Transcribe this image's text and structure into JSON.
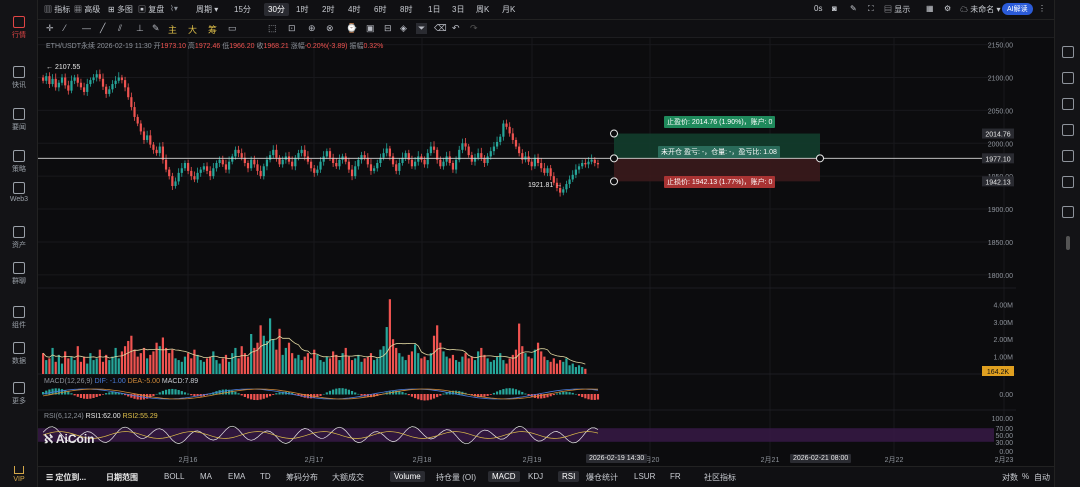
{
  "sidebar": {
    "items": [
      {
        "label": "行情",
        "icon": "bar-chart-icon",
        "active": true
      },
      {
        "label": "快讯",
        "icon": "flash-icon"
      },
      {
        "label": "要闻",
        "icon": "news-icon"
      },
      {
        "label": "策略",
        "icon": "strategy-icon"
      },
      {
        "label": "Web3",
        "icon": "web3-icon"
      },
      {
        "label": "资产",
        "icon": "wallet-icon"
      },
      {
        "label": "群聊",
        "icon": "chat-icon"
      },
      {
        "label": "组件",
        "icon": "widget-icon"
      },
      {
        "label": "数据",
        "icon": "data-icon"
      },
      {
        "label": "更多",
        "icon": "more-icon"
      }
    ],
    "vip": "VIP"
  },
  "toolbar": {
    "indicator": "指标",
    "advanced": "高级",
    "multi": "多图",
    "replay": "复盘",
    "period": "周期",
    "intervals": [
      "15分",
      "30分",
      "1时",
      "2时",
      "4时",
      "6时",
      "8时",
      "1日",
      "3日",
      "周K",
      "月K"
    ],
    "selected_interval": "30分",
    "countdown": "0s",
    "display": "显示",
    "unnamed": "未命名",
    "ai": "AI解读"
  },
  "tools": {
    "main": "主",
    "big": "大",
    "fib": "筹"
  },
  "header": {
    "symbol": "ETH/USDT永续",
    "datetime": "2026-02-19 11:30",
    "open_label": "开",
    "open": "1973.10",
    "high_label": "高",
    "high": "1972.46",
    "low_label": "低",
    "low": "1966.20",
    "close_label": "收",
    "close": "1968.21",
    "change_label": "涨幅",
    "change": "-0.20%(-3.89)",
    "amplitude_label": "振幅",
    "amplitude": "0.32%"
  },
  "price_axis": {
    "ticks": [
      "2150.00",
      "2100.00",
      "2050.00",
      "2000.00",
      "1950.00",
      "1900.00",
      "1850.00",
      "1800.00"
    ],
    "tp_tag": "2014.76",
    "current_tag": "1977.10",
    "sl_tag": "1942.13"
  },
  "annotations": {
    "high_mark": "← 2107.55",
    "low_mark": "1921.81 →",
    "tp": "止盈价: 2014.76 (1.90%)，账户: 0",
    "pos": "未开仓 盈亏: -，仓量: -，盈亏比: 1.08",
    "sl": "止损价: 1942.13 (1.77%)，账户: 0"
  },
  "volume_axis": {
    "ticks": [
      "4.00M",
      "3.00M",
      "2.00M",
      "1.00M"
    ],
    "current": "164.2K"
  },
  "macd": {
    "label": "MACD(12,26,9)",
    "dif": "DIF: -1.00",
    "dea": "DEA:-5.00",
    "macd": "MACD:7.89",
    "axis": "0.00"
  },
  "rsi": {
    "label": "RSI(6,12,24)",
    "rsi1": "RSI1:62.00",
    "rsi2": "RSI2:55.29",
    "axis": [
      "100.00",
      "70.00",
      "50.00",
      "30.00",
      "0.00"
    ]
  },
  "x_axis": {
    "ticks": [
      "2月16",
      "2月17",
      "2月18",
      "2月19",
      "2月20",
      "2月21",
      "2月22",
      "2月23"
    ],
    "cursor_start": "2026-02-19 14:30",
    "cursor_end": "2026-02-21 08:00"
  },
  "watermark": "AiCoin",
  "bottom": {
    "locate": "定位到...",
    "date_range": "日期范围",
    "tabs": [
      "BOLL",
      "MA",
      "EMA",
      "TD",
      "筹码分布",
      "大额成交",
      "Volume",
      "持仓量 (OI)",
      "MACD",
      "KDJ",
      "RSI",
      "爆仓统计",
      "LSUR",
      "FR",
      "社区指标"
    ],
    "selected_tabs": [
      "Volume",
      "MACD",
      "RSI"
    ],
    "log": "对数",
    "pct": "%",
    "auto": "自动"
  },
  "colors": {
    "up": "#26a69a",
    "down": "#ef5350",
    "accent": "#2b5bd8",
    "rsi_band": "#3a1a4a"
  },
  "chart_data": {
    "type": "candlestick",
    "symbol": "ETH/USDT",
    "interval": "30m",
    "visible_high": 2107.55,
    "visible_low": 1921.81,
    "ylim": [
      1780,
      2160
    ],
    "take_profit": 2014.76,
    "entry": 1977.1,
    "stop_loss": 1942.13,
    "closes": [
      2095,
      2102,
      2090,
      2098,
      2085,
      2092,
      2100,
      2088,
      2080,
      2095,
      2100,
      2092,
      2085,
      2078,
      2090,
      2096,
      2100,
      2105,
      2098,
      2086,
      2075,
      2082,
      2090,
      2095,
      2100,
      2096,
      2085,
      2070,
      2055,
      2040,
      2030,
      2018,
      2005,
      2012,
      1998,
      1990,
      1985,
      1995,
      1975,
      1960,
      1950,
      1935,
      1942,
      1955,
      1962,
      1970,
      1958,
      1950,
      1945,
      1955,
      1960,
      1965,
      1958,
      1950,
      1962,
      1970,
      1975,
      1968,
      1960,
      1972,
      1980,
      1990,
      1985,
      1978,
      1970,
      1962,
      1975,
      1968,
      1958,
      1950,
      1965,
      1975,
      1982,
      1990,
      1978,
      1968,
      1975,
      1980,
      1972,
      1965,
      1978,
      1985,
      1990,
      1980,
      1972,
      1962,
      1955,
      1960,
      1972,
      1980,
      1988,
      1978,
      1970,
      1965,
      1975,
      1980,
      1972,
      1960,
      1950,
      1965,
      1975,
      1982,
      1978,
      1968,
      1958,
      1962,
      1970,
      1978,
      1985,
      1992,
      1980,
      1968,
      1958,
      1970,
      1978,
      1985,
      1975,
      1965,
      1972,
      1980,
      1975,
      1968,
      1985,
      1995,
      1990,
      1975,
      1965,
      1972,
      1980,
      1970,
      1960,
      1975,
      1990,
      2000,
      1995,
      1982,
      1972,
      1978,
      1985,
      1978,
      1970,
      1980,
      1988,
      1995,
      2002,
      2010,
      2030,
      2025,
      2015,
      2005,
      1995,
      1985,
      1975,
      1980,
      1972,
      1965,
      1978,
      1970,
      1962,
      1955,
      1962,
      1950,
      1940,
      1932,
      1925,
      1930,
      1938,
      1945,
      1952,
      1960,
      1965,
      1970,
      1968,
      1972,
      1975,
      1970,
      1968
    ],
    "volumes_m": [
      1.2,
      0.8,
      0.9,
      1.5,
      0.7,
      1.1,
      0.6,
      1.3,
      0.9,
      1.0,
      0.8,
      1.6,
      0.7,
      1.0,
      0.6,
      1.2,
      0.8,
      0.9,
      1.4,
      0.7,
      1.1,
      0.8,
      1.0,
      1.5,
      0.9,
      1.3,
      1.6,
      1.9,
      2.2,
      1.4,
      1.0,
      1.2,
      1.5,
      0.9,
      1.1,
      1.3,
      1.8,
      1.6,
      2.1,
      1.5,
      1.2,
      1.4,
      0.9,
      0.8,
      0.7,
      1.0,
      1.2,
      0.9,
      1.4,
      1.1,
      0.8,
      0.7,
      0.9,
      1.0,
      1.3,
      0.8,
      0.6,
      0.9,
      1.1,
      0.7,
      1.2,
      1.5,
      0.9,
      1.6,
      1.2,
      1.0,
      2.3,
      1.5,
      1.8,
      2.8,
      2.2,
      1.9,
      3.2,
      2.0,
      1.4,
      2.6,
      1.1,
      1.5,
      1.8,
      1.2,
      0.9,
      1.1,
      0.8,
      1.0,
      1.2,
      0.9,
      1.4,
      1.1,
      0.8,
      0.7,
      1.0,
      0.9,
      1.3,
      1.1,
      0.8,
      1.2,
      1.5,
      1.0,
      0.8,
      0.9,
      1.1,
      0.7,
      0.9,
      1.0,
      1.2,
      0.8,
      0.9,
      1.4,
      1.6,
      2.7,
      4.3,
      2.0,
      1.5,
      1.2,
      1.0,
      0.8,
      1.1,
      1.3,
      1.7,
      1.2,
      0.9,
      1.0,
      0.8,
      1.2,
      2.2,
      2.8,
      1.8,
      1.3,
      1.0,
      0.9,
      1.1,
      0.8,
      0.7,
      1.0,
      1.2,
      0.9,
      1.0,
      0.8,
      1.3,
      1.5,
      1.1,
      0.9,
      0.7,
      0.8,
      1.0,
      1.2,
      0.8,
      0.6,
      0.9,
      1.1,
      1.4,
      2.9,
      1.6,
      1.2,
      1.0,
      0.9,
      1.4,
      1.8,
      1.3,
      1.0,
      0.8,
      0.7,
      0.9,
      0.6,
      0.8,
      0.7,
      0.9,
      0.5,
      0.6,
      0.4,
      0.5,
      0.4,
      0.3
    ],
    "x_labels": [
      "2月16",
      "2月17",
      "2月18",
      "2月19",
      "2月20",
      "2月21",
      "2月22",
      "2月23"
    ]
  }
}
